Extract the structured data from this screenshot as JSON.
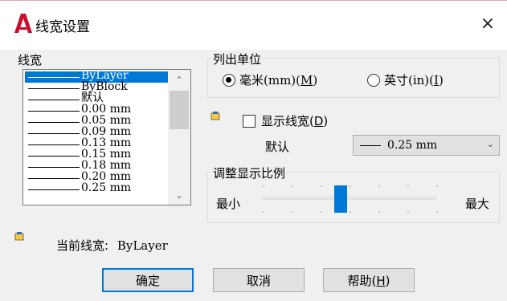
{
  "window": {
    "title": "线宽设置",
    "close_glyph": "×",
    "app_icon": "autocad-a-icon",
    "accent": "#0078d7",
    "icon_red": "#c8102e"
  },
  "lineweight_list": {
    "label": "线宽",
    "items": [
      "ByLayer",
      "ByBlock",
      "默认",
      "0.00 mm",
      "0.05 mm",
      "0.09 mm",
      "0.13 mm",
      "0.15 mm",
      "0.18 mm",
      "0.20 mm",
      "0.25 mm"
    ],
    "selected": "ByLayer"
  },
  "units": {
    "label": "列出单位",
    "mm_label": "毫米(mm)(",
    "mm_key": "M",
    "in_label": "英寸(in)(",
    "in_key": "I",
    "close_paren": ")",
    "selected": "mm"
  },
  "display": {
    "label": "显示线宽(",
    "key": "D",
    "close_paren": ")",
    "checked": false
  },
  "default_field": {
    "label": "默认",
    "value": "0.25 mm"
  },
  "scale": {
    "label": "调整显示比例",
    "min_label": "最小",
    "max_label": "最大",
    "position": 0.45
  },
  "current": {
    "label": "当前线宽:",
    "value": "ByLayer"
  },
  "buttons": {
    "ok": "确定",
    "cancel": "取消",
    "help_label": "帮助(",
    "help_key": "H",
    "close_paren": ")"
  }
}
